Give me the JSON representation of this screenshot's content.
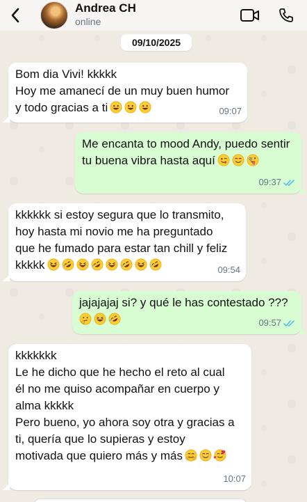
{
  "header": {
    "contact_name": "Andrea CH",
    "status": "online"
  },
  "date_chip": "09/10/2025",
  "messages": [
    {
      "direction": "in",
      "lines": [
        "Bom dia Vivi! kkkkk",
        "Hoy me amanecí de un muy buen humor",
        "y todo gracias a ti"
      ],
      "emojis": [
        "grinning",
        "grinning",
        "grinning"
      ],
      "time": "09:07"
    },
    {
      "direction": "out",
      "lines": [
        "Me encanta to mood Andy, puedo sentir",
        "tu buena vibra hasta aquí"
      ],
      "emojis": [
        "wink",
        "smile",
        "zany"
      ],
      "time": "09:37",
      "read": true
    },
    {
      "direction": "in",
      "lines": [
        "kkkkkk si estoy segura que lo transmito,",
        "hoy hasta mi novio me ha preguntado",
        "que he fumado para estar tan chill y feliz",
        "kkkkk"
      ],
      "emojis": [
        "laughing",
        "rofl",
        "laughing",
        "rofl",
        "laughing",
        "rofl",
        "laughing",
        "rofl"
      ],
      "time": "09:54"
    },
    {
      "direction": "out",
      "lines": [
        "jajajajaj si? y qué le has contestado ???"
      ],
      "emojis": [
        "thinking",
        "laughing",
        "rofl"
      ],
      "time": "09:57",
      "read": true
    },
    {
      "direction": "in",
      "lines": [
        "kkkkkkk",
        "Le he dicho que he hecho el reto al cual",
        "él no me quiso acompañar en cuerpo y",
        "alma kkkkk",
        "Pero bueno, yo ahora soy otra y gracias a",
        "ti, quería que lo supieras y estoy",
        "motivada que quiero más y más"
      ],
      "emojis": [
        "hug",
        "smile",
        "hearts"
      ],
      "time": "10:07"
    }
  ],
  "colors": {
    "incoming": "#ffffff",
    "outgoing": "#d9fdd3",
    "read_ticks": "#53bdeb",
    "background": "#efeae2"
  }
}
